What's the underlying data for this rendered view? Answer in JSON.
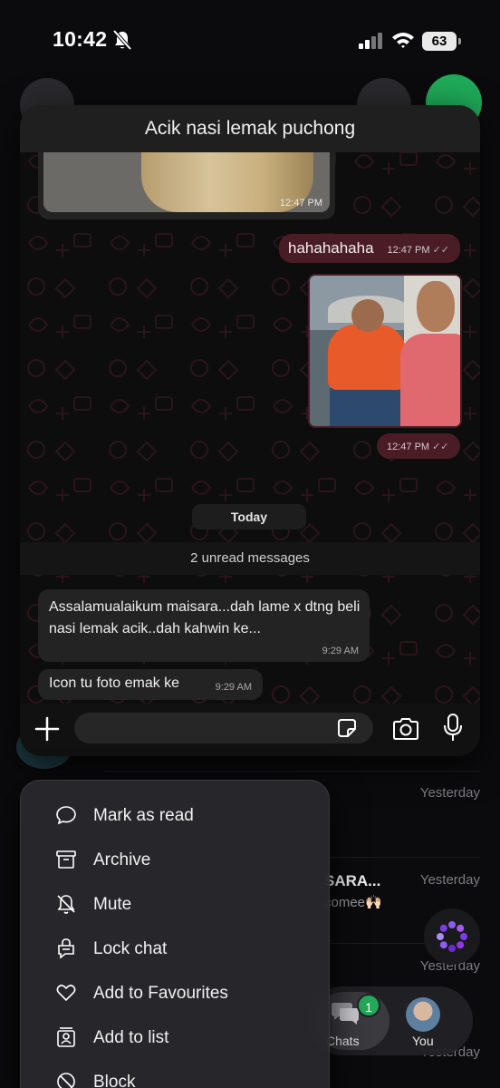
{
  "status_bar": {
    "time": "10:42",
    "battery": "63"
  },
  "chat": {
    "title": "Acik nasi lemak puchong",
    "messages": [
      {
        "type": "photo",
        "direction": "in",
        "time": "12:47 PM"
      },
      {
        "type": "text",
        "direction": "out",
        "text": "hahahahaha",
        "time": "12:47 PM"
      },
      {
        "type": "gif",
        "direction": "out",
        "time": "12:47 PM"
      }
    ],
    "date_separator": "Today",
    "unread_banner": "2 unread messages",
    "incoming": [
      {
        "text": "Assalamualaikum maisara...dah lame x dtng beli nasi lemak acik..dah kahwin ke...",
        "time": "9:29 AM"
      },
      {
        "text": "Icon tu foto emak ke",
        "time": "9:29 AM"
      }
    ],
    "composer": {
      "placeholder": ""
    }
  },
  "context_menu": {
    "items": [
      {
        "label": "Mark as read",
        "icon": "chat-bubble-icon"
      },
      {
        "label": "Archive",
        "icon": "archive-icon"
      },
      {
        "label": "Mute",
        "icon": "bell-off-icon"
      },
      {
        "label": "Lock chat",
        "icon": "lock-chat-icon"
      },
      {
        "label": "Add to Favourites",
        "icon": "heart-icon"
      },
      {
        "label": "Add to list",
        "icon": "add-to-list-icon"
      },
      {
        "label": "Block",
        "icon": "block-icon"
      }
    ]
  },
  "chat_list": {
    "times": [
      "Yesterday",
      "Yesterday",
      "Yesterday",
      "Yesterday"
    ],
    "partial_name": "SARA...",
    "partial_preview": "comee🙌🏻"
  },
  "bottom_nav": {
    "chats_label": "Chats",
    "chats_badge": "1",
    "you_label": "You"
  },
  "colors": {
    "outgoing_bubble": "#4a1c26",
    "incoming_bubble": "#232324",
    "accent_green": "#25a85a"
  }
}
